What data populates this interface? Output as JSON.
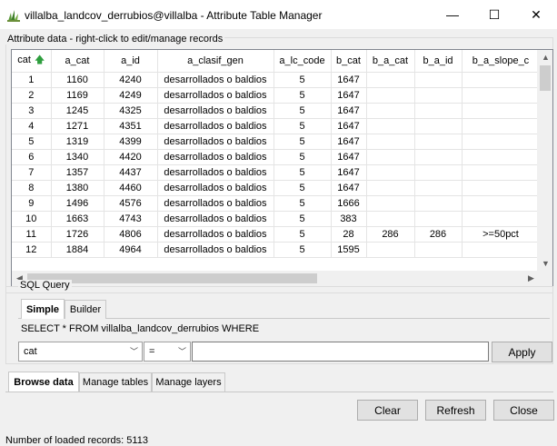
{
  "window": {
    "title": "villalba_landcov_derrubios@villalba - Attribute Table Manager",
    "minimize": "—",
    "maximize": "☐",
    "close": "✕"
  },
  "attribute_group": {
    "title": "Attribute data - right-click to edit/manage records"
  },
  "table": {
    "columns": [
      "cat",
      "a_cat",
      "a_id",
      "a_clasif_gen",
      "a_lc_code",
      "b_cat",
      "b_a_cat",
      "b_a_id",
      "b_a_slope_c"
    ],
    "sorted_column_icon": "sort-ascending-green-icon",
    "rows": [
      [
        "1",
        "1160",
        "4240",
        "desarrollados o baldios",
        "5",
        "1647",
        "",
        "",
        ""
      ],
      [
        "2",
        "1169",
        "4249",
        "desarrollados o baldios",
        "5",
        "1647",
        "",
        "",
        ""
      ],
      [
        "3",
        "1245",
        "4325",
        "desarrollados o baldios",
        "5",
        "1647",
        "",
        "",
        ""
      ],
      [
        "4",
        "1271",
        "4351",
        "desarrollados o baldios",
        "5",
        "1647",
        "",
        "",
        ""
      ],
      [
        "5",
        "1319",
        "4399",
        "desarrollados o baldios",
        "5",
        "1647",
        "",
        "",
        ""
      ],
      [
        "6",
        "1340",
        "4420",
        "desarrollados o baldios",
        "5",
        "1647",
        "",
        "",
        ""
      ],
      [
        "7",
        "1357",
        "4437",
        "desarrollados o baldios",
        "5",
        "1647",
        "",
        "",
        ""
      ],
      [
        "8",
        "1380",
        "4460",
        "desarrollados o baldios",
        "5",
        "1647",
        "",
        "",
        ""
      ],
      [
        "9",
        "1496",
        "4576",
        "desarrollados o baldios",
        "5",
        "1666",
        "",
        "",
        ""
      ],
      [
        "10",
        "1663",
        "4743",
        "desarrollados o baldios",
        "5",
        "383",
        "",
        "",
        ""
      ],
      [
        "11",
        "1726",
        "4806",
        "desarrollados o baldios",
        "5",
        "28",
        "286",
        "286",
        ">=50pct"
      ],
      [
        "12",
        "1884",
        "4964",
        "desarrollados o baldios",
        "5",
        "1595",
        "",
        "",
        ""
      ]
    ]
  },
  "sql": {
    "title": "SQL Query",
    "tabs": [
      "Simple",
      "Builder"
    ],
    "active_tab": "Simple",
    "query_text": "SELECT * FROM villalba_landcov_derrubios WHERE",
    "column_select": "cat",
    "operator_select": "=",
    "value_input": "",
    "apply_label": "Apply"
  },
  "bottom_tabs": [
    "Browse data",
    "Manage tables",
    "Manage layers"
  ],
  "active_bottom_tab": "Browse data",
  "buttons": {
    "clear": "Clear",
    "refresh": "Refresh",
    "close": "Close"
  },
  "status": "Number of loaded records: 5113",
  "colors": {
    "sort_arrow": "#2e9e3e",
    "window_bg": "#f0f0f0"
  }
}
